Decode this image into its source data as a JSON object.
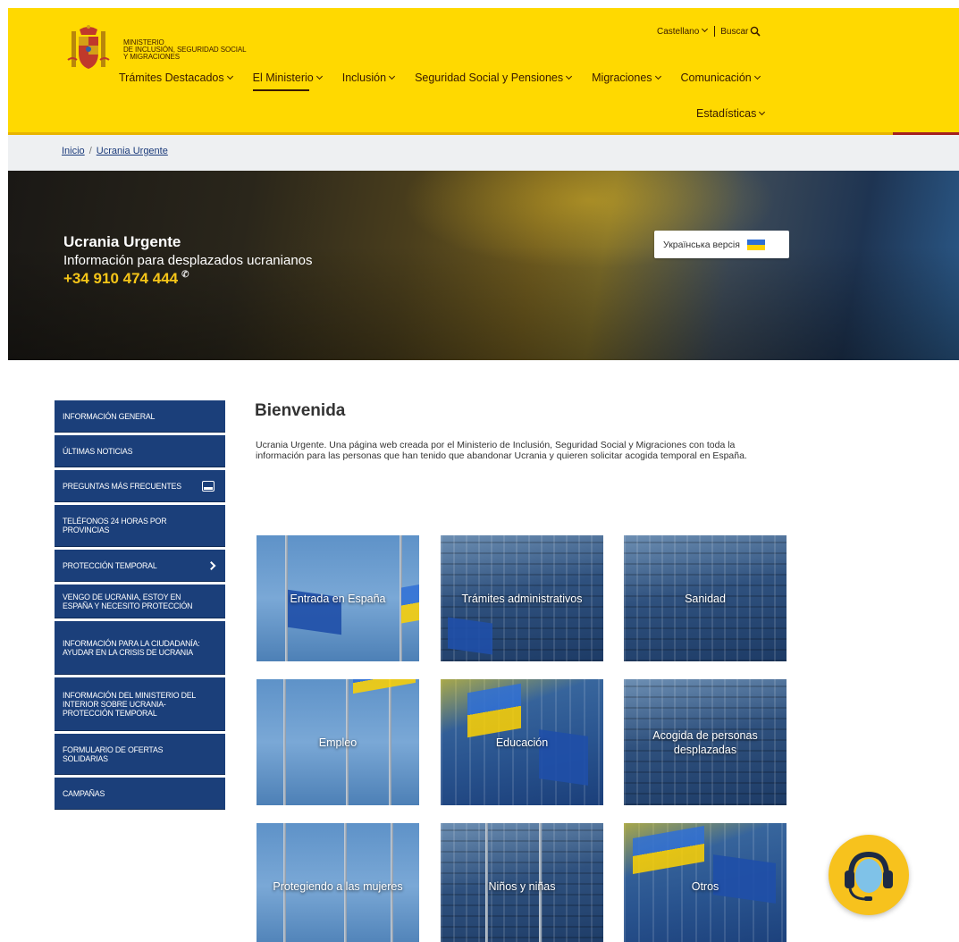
{
  "header": {
    "ministry_lines": [
      "MINISTERIO",
      "DE INCLUSIÓN, SEGURIDAD SOCIAL",
      "Y MIGRACIONES"
    ],
    "language": "Castellano",
    "search": "Buscar",
    "nav": [
      "Trámites Destacados",
      "El Ministerio",
      "Inclusión",
      "Seguridad Social y Pensiones",
      "Migraciones",
      "Comunicación"
    ],
    "nav_active": "El Ministerio",
    "nav_second_row": "Estadísticas",
    "brand_yellow": "#ffd900"
  },
  "breadcrumb": {
    "home": "Inicio",
    "current": "Ucrania Urgente"
  },
  "hero": {
    "title": "Ucrania Urgente",
    "subtitle": "Información para desplazados ucranianos",
    "phone": "+34 910 474 444",
    "ukr_button": "Українська версія"
  },
  "sidebar": {
    "items": [
      "INFORMACIÓN GENERAL",
      "ÚLTIMAS NOTICIAS",
      "PREGUNTAS MÁS FRECUENTES",
      "TELÉFONOS 24 HORAS POR PROVINCIAS",
      "PROTECCIÓN TEMPORAL",
      "VENGO DE UCRANIA, ESTOY EN ESPAÑA Y NECESITO PROTECCIÓN",
      "INFORMACIÓN PARA LA CIUDADANÍA: AYUDAR EN LA CRISIS DE UCRANIA",
      "INFORMACIÓN DEL MINISTERIO DEL INTERIOR SOBRE UCRANIA- PROTECCIÓN TEMPORAL",
      "FORMULARIO DE OFERTAS SOLIDARIAS",
      "CAMPAÑAS"
    ],
    "color": "#1b3f7a"
  },
  "main": {
    "title": "Bienvenida",
    "intro": "Ucrania Urgente. Una página web creada por el Ministerio de Inclusión, Seguridad Social y Migraciones con toda la información para las personas que han tenido que abandonar Ucrania y quieren solicitar acogida temporal en España.",
    "tiles": [
      "Entrada en España",
      "Trámites administrativos",
      "Sanidad",
      "Empleo",
      "Educación",
      "Acogida de personas desplazadas",
      "Protegiendo a las mujeres",
      "Niños y niñas",
      "Otros"
    ]
  },
  "help": {
    "icon": "headset-icon"
  }
}
